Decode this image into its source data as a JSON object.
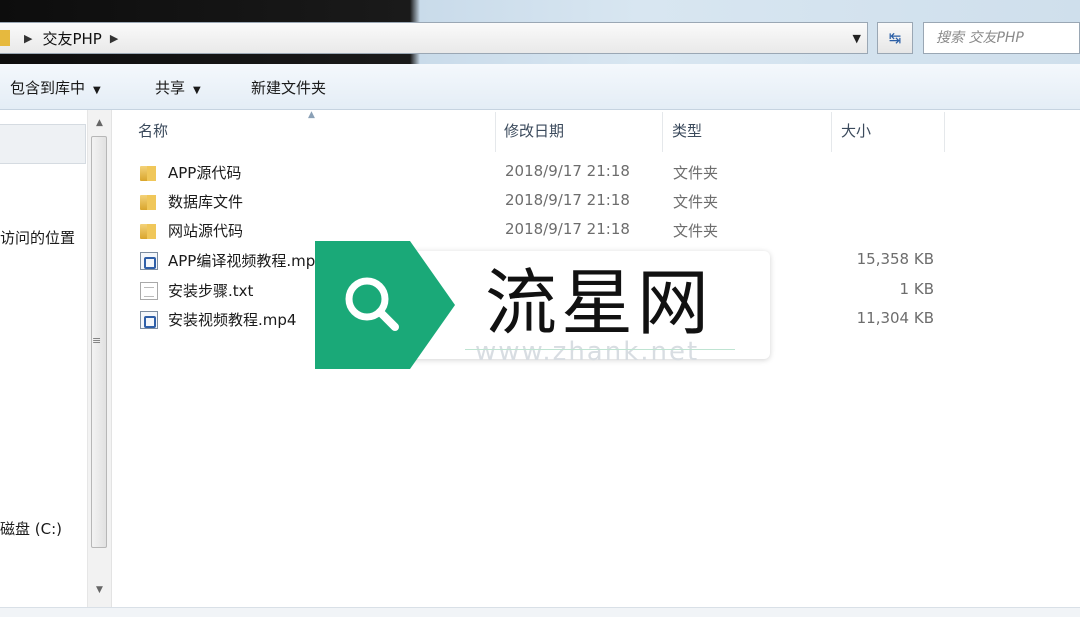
{
  "address": {
    "crumb": "交友PHP",
    "search_placeholder": "搜索 交友PHP"
  },
  "toolbar": {
    "include_label": "包含到库中",
    "share_label": "共享",
    "new_folder_label": "新建文件夹"
  },
  "nav": {
    "items": [
      {
        "label": "访问的位置"
      },
      {
        "label": "磁盘 (C:)"
      }
    ]
  },
  "columns": {
    "name": "名称",
    "date": "修改日期",
    "type": "类型",
    "size": "大小"
  },
  "files": [
    {
      "name": "APP源代码",
      "date": "2018/9/17 21:18",
      "type": "文件夹",
      "size": "",
      "icon": "folder-icon"
    },
    {
      "name": "数据库文件",
      "date": "2018/9/17 21:18",
      "type": "文件夹",
      "size": "",
      "icon": "folder-icon"
    },
    {
      "name": "网站源代码",
      "date": "2018/9/17 21:18",
      "type": "文件夹",
      "size": "",
      "icon": "folder-icon"
    },
    {
      "name": "APP编译视频教程.mp4",
      "date": "",
      "type": "",
      "size": "15,358 KB",
      "icon": "video-file-icon"
    },
    {
      "name": "安装步骤.txt",
      "date": "",
      "type": "",
      "size": "1 KB",
      "icon": "text-file-icon"
    },
    {
      "name": "安装视频教程.mp4",
      "date": "",
      "type": "",
      "size": "11,304 KB",
      "icon": "video-file-icon"
    }
  ],
  "watermark": {
    "text": "流星网",
    "url": "www.zhank.net",
    "color": "#1aa978"
  }
}
